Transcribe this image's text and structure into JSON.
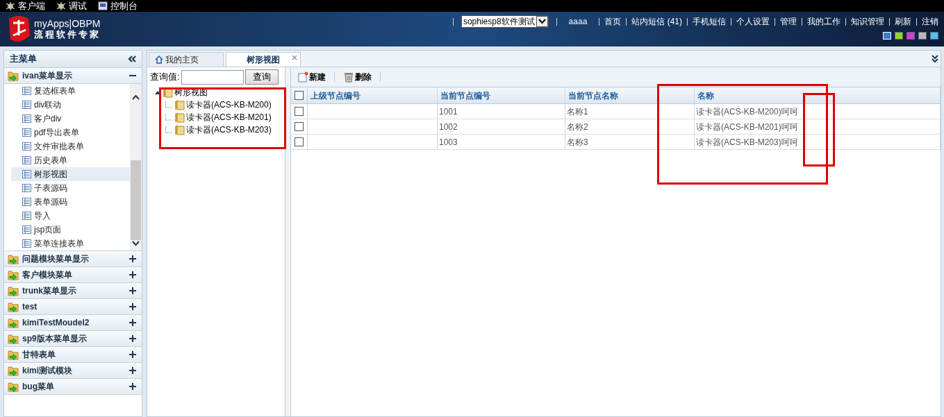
{
  "top_bar": {
    "items": [
      {
        "label": "客户端",
        "kind": "bug"
      },
      {
        "label": "调试",
        "kind": "bug"
      },
      {
        "label": "控制台",
        "kind": "console"
      }
    ]
  },
  "header": {
    "brand": "myApps|OBPM",
    "slogan": "流程软件专家",
    "app_select": {
      "value": "sophiesp8软件测试"
    },
    "user": "aaaa",
    "links": [
      "首页",
      "站内短信 (41)",
      "手机短信",
      "个人设置",
      "管理",
      "我的工作",
      "知识管理",
      "刷新",
      "注销"
    ],
    "themes": [
      {
        "color": "#3a7bd5",
        "selected": true
      },
      {
        "color": "#8fd628",
        "selected": false
      },
      {
        "color": "#d63ad0",
        "selected": false
      },
      {
        "color": "#b8b8b8",
        "selected": false
      },
      {
        "color": "#4cc0f0",
        "selected": false
      }
    ]
  },
  "sidebar": {
    "title": "主菜单",
    "groups": [
      {
        "label": "ivan菜单显示",
        "expanded": true,
        "items": [
          {
            "label": "复选框表单",
            "selected": false
          },
          {
            "label": "div联动",
            "selected": false
          },
          {
            "label": "客户div",
            "selected": false
          },
          {
            "label": "pdf导出表单",
            "selected": false
          },
          {
            "label": "文件审批表单",
            "selected": false
          },
          {
            "label": "历史表单",
            "selected": false
          },
          {
            "label": "树形视图",
            "selected": true
          },
          {
            "label": "子表源码",
            "selected": false
          },
          {
            "label": "表单源码",
            "selected": false
          },
          {
            "label": "导入",
            "selected": false
          },
          {
            "label": "jsp页面",
            "selected": false
          },
          {
            "label": "菜单连接表单",
            "selected": false
          }
        ]
      },
      {
        "label": "问题模块菜单显示",
        "expanded": false
      },
      {
        "label": "客户模块菜单",
        "expanded": false
      },
      {
        "label": "trunk菜单显示",
        "expanded": false
      },
      {
        "label": "test",
        "expanded": false
      },
      {
        "label": "kimiTestMoudel2",
        "expanded": false
      },
      {
        "label": "sp9版本菜单显示",
        "expanded": false
      },
      {
        "label": "甘特表单",
        "expanded": false
      },
      {
        "label": "kimi测试模块",
        "expanded": false
      },
      {
        "label": "bug菜单",
        "expanded": false
      }
    ]
  },
  "tabs": [
    {
      "label": "我的主页",
      "selected": false,
      "closable": false
    },
    {
      "label": "树形视图",
      "selected": true,
      "closable": true
    }
  ],
  "tree_panel": {
    "query_label": "查询值:",
    "query_button": "查询",
    "tree": [
      {
        "label": "树形视图",
        "expanded": true,
        "children": [
          {
            "label": "读卡器(ACS-KB-M200)"
          },
          {
            "label": "读卡器(ACS-KB-M201)"
          },
          {
            "label": "读卡器(ACS-KB-M203)"
          }
        ]
      }
    ]
  },
  "toolbar": [
    {
      "label": "新建",
      "kind": "new"
    },
    {
      "label": "删除",
      "kind": "delete"
    }
  ],
  "table": {
    "all_checked": false,
    "columns": [
      "上级节点编号",
      "当前节点编号",
      "当前节点名称",
      "名称"
    ],
    "rows": [
      {
        "checked": false,
        "cells": [
          "",
          "1001",
          "名称1",
          "读卡器(ACS-KB-M200)呵呵"
        ]
      },
      {
        "checked": false,
        "cells": [
          "",
          "1002",
          "名称2",
          "读卡器(ACS-KB-M201)呵呵"
        ]
      },
      {
        "checked": false,
        "cells": [
          "",
          "1003",
          "名称3",
          "读卡器(ACS-KB-M203)呵呵"
        ]
      }
    ]
  }
}
